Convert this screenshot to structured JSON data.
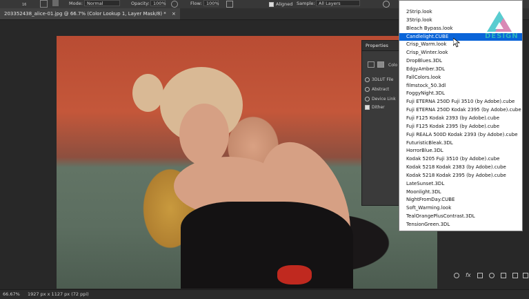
{
  "options_bar": {
    "brush_size": "16",
    "mode_label": "Mode:",
    "mode_value": "Normal",
    "opacity_label": "Opacity:",
    "opacity_value": "100%",
    "flow_label": "Flow:",
    "flow_value": "100%",
    "aligned_label": "Aligned",
    "sample_label": "Sample:",
    "sample_value": "All Layers"
  },
  "document_tab": {
    "title": "203352438_alice-01.jpg @ 66.7% (Color Lookup 1, Layer Mask/8) *",
    "close": "×"
  },
  "properties_panel": {
    "title": "Properties",
    "type_label": "Colo",
    "options": [
      {
        "label": "3DLUT File",
        "kind": "radio"
      },
      {
        "label": "Abstract",
        "kind": "radio"
      },
      {
        "label": "Device Link",
        "kind": "radio"
      },
      {
        "label": "Dither",
        "kind": "check"
      }
    ]
  },
  "lut_dropdown": {
    "selected_index": 3,
    "items": [
      "2Strip.look",
      "3Strip.look",
      "Bleach Bypass.look",
      "Candlelight.CUBE",
      "Crisp_Warm.look",
      "Crisp_Winter.look",
      "DropBlues.3DL",
      "EdgyAmber.3DL",
      "FallColors.look",
      "filmstock_50.3dl",
      "FoggyNight.3DL",
      "Fuji ETERNA 250D Fuji 3510 (by Adobe).cube",
      "Fuji ETERNA 250D Kodak 2395 (by Adobe).cube",
      "Fuji F125 Kodak 2393 (by Adobe).cube",
      "Fuji F125 Kodak 2395 (by Adobe).cube",
      "Fuji REALA 500D Kodak 2393 (by Adobe).cube",
      "FuturisticBleak.3DL",
      "HorrorBlue.3DL",
      "Kodak 5205 Fuji 3510 (by Adobe).cube",
      "Kodak 5218 Kodak 2383 (by Adobe).cube",
      "Kodak 5218 Kodak 2395 (by Adobe).cube",
      "LateSunset.3DL",
      "Moonlight.3DL",
      "NightFromDay.CUBE",
      "Soft_Warming.look",
      "TealOrangePlusContrast.3DL",
      "TensionGreen.3DL"
    ]
  },
  "watermark": {
    "text": "DESIGN"
  },
  "status_bar": {
    "zoom": "66.67%",
    "doc_info": "1927 px x 1127 px (72 ppi)"
  },
  "colors": {
    "selection": "#0a64d8",
    "logo_teal": "#3cc3c8",
    "logo_pink": "#f07bb0"
  }
}
